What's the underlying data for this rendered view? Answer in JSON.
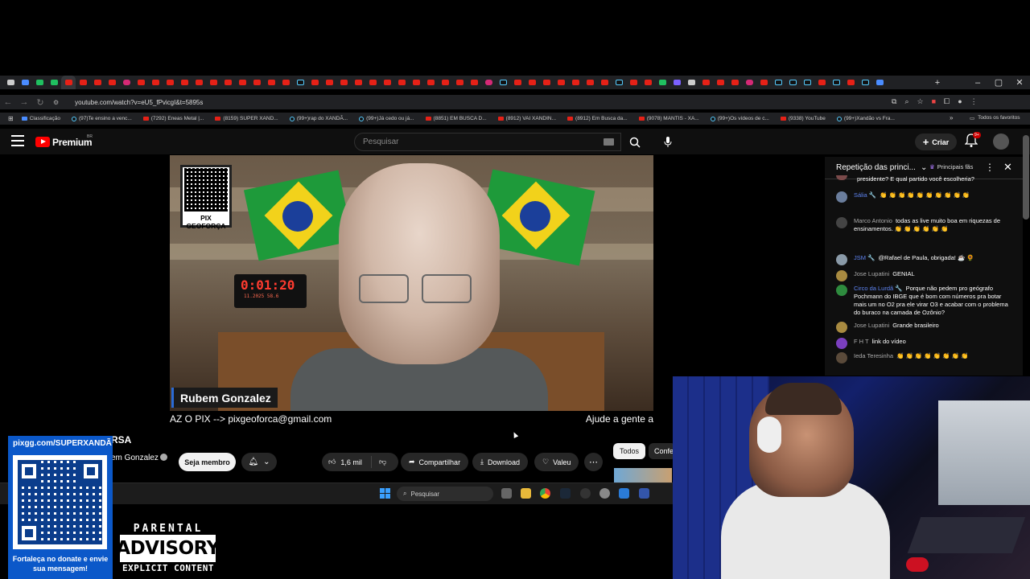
{
  "browser": {
    "url": "youtube.com/watch?v=eU5_fPvicgI&t=5895s",
    "bookmarks": [
      {
        "label": "Classificação",
        "icon": "blue"
      },
      {
        "label": "(97)Te ensino a venc...",
        "icon": "tt"
      },
      {
        "label": "(7292) Eneas Metal |...",
        "icon": "yt"
      },
      {
        "label": "(8159) SUPER XAND...",
        "icon": "yt"
      },
      {
        "label": "(99+)rap do XANDÃ...",
        "icon": "tt"
      },
      {
        "label": "(99+)Já cedo ou já...",
        "icon": "tt"
      },
      {
        "label": "(8851) EM BUSCA D...",
        "icon": "yt"
      },
      {
        "label": "(8912) VAI XANDIN...",
        "icon": "yt"
      },
      {
        "label": "(8912) Em Busca da...",
        "icon": "yt"
      },
      {
        "label": "(9078) MANTIS - XA...",
        "icon": "yt"
      },
      {
        "label": "(99+)Os vídeos de c...",
        "icon": "tt"
      },
      {
        "label": "(9338) YouTube",
        "icon": "yt"
      },
      {
        "label": "(99+)Xandão vs Fra...",
        "icon": "tt"
      }
    ],
    "all_favorites": "Todos os favoritos"
  },
  "youtube": {
    "logo_text": "Premium",
    "logo_region": "BR",
    "search_placeholder": "Pesquisar",
    "create_label": "Criar",
    "notif_badge": "9+"
  },
  "video": {
    "qr_label": "PIX GEOFORÇA",
    "clock_time": "0:01:20",
    "clock_sub": "11.2025  58.6",
    "nameplate": "Rubem Gonzalez",
    "ticker_left": "AZ O PIX --> pixgeoforca@gmail.com",
    "ticker_right": "Ajude a gente a",
    "title_fragment": "RSA",
    "channel": "em Gonzalez"
  },
  "actions": {
    "member": "Seja membro",
    "likes": "1,6 mil",
    "share": "Compartilhar",
    "download": "Download",
    "thanks": "Valeu",
    "chip_all": "Todos",
    "chip_conf": "Confe"
  },
  "taskbar": {
    "search": "Pesquisar"
  },
  "chat": {
    "title": "Repetição das princi...",
    "filter": "Principais fãs",
    "messages": [
      {
        "author": "",
        "text": "presidente? E qual partido você escolheria?",
        "avatar": "#7a4a4a",
        "mod": false
      },
      {
        "author": "Sália 🔧",
        "text": "👏 👏 👏 👏 👏 👏 👏 👏 👏 👏",
        "avatar": "#6a7d9c",
        "mod": true
      },
      {
        "author": "Marco Antonio",
        "text": "todas as live muito boa em riquezas de ensinamentos. 👏 👏 👏 👏 👏 👏",
        "avatar": "#444",
        "mod": false
      },
      {
        "author": "JSM 🔧",
        "text": "@Rafael de Paula, obrigada! ☕ 🌻",
        "avatar": "#8a9aa8",
        "mod": true
      },
      {
        "author": "Jose Lupatini",
        "text": "GENIAL",
        "avatar": "#a88a40",
        "mod": false
      },
      {
        "author": "Circo da Lurdã 🔧",
        "text": "Porque não pedem pro geógrafo Pochmann do IBGE que é bom com números pra botar mais um no O2 pra ele virar O3 e acabar com o problema do buraco na camada de Ozônio?",
        "avatar": "#2e8b3e",
        "mod": true
      },
      {
        "author": "Jose Lupatini",
        "text": "Grande brasileiro",
        "avatar": "#a88a40",
        "mod": false
      },
      {
        "author": "F H T",
        "text": "link do vídeo",
        "avatar": "#7b3fbf",
        "mod": false
      },
      {
        "author": "Ieda Teresinha",
        "text": "👏 👏 👏 👏 👏 👏 👏 👏",
        "avatar": "#5a4a3a",
        "mod": false
      }
    ]
  },
  "overlay": {
    "pix_url": "pixgg.com/SUPERXANDÃ",
    "pix_message": "Fortaleça no donate e envie sua mensagem!",
    "advisory_top": "PARENTAL",
    "advisory_mid": "ADVISORY",
    "advisory_bottom": "EXPLICIT CONTENT"
  }
}
